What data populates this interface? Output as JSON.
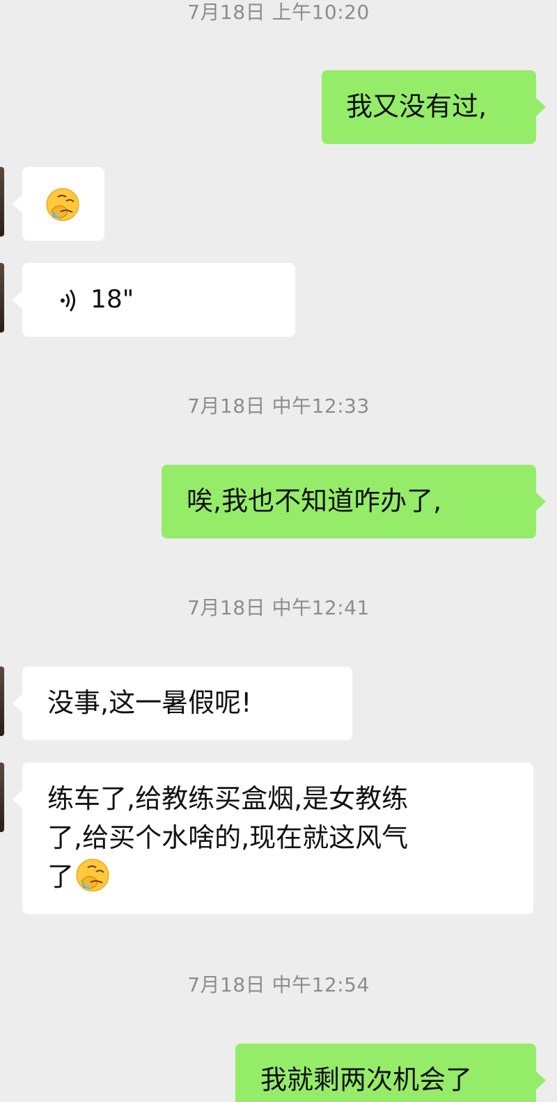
{
  "messages": {
    "ts1": "7月18日 上午10:20",
    "out1": "我又没有过,",
    "in_emoji_name": "facepalm-crying-emoji",
    "voice_duration": "18\"",
    "ts2": "7月18日 中午12:33",
    "out2": "唉,我也不知道咋办了,",
    "ts3": "7月18日 中午12:41",
    "in2": "没事,这一暑假呢!",
    "in3": "练车了,给教练买盒烟,是女教练\n了,给买个水啥的,现在就这风气\n了",
    "ts4": "7月18日 中午12:54",
    "out3": "我就剩两次机会了"
  },
  "colors": {
    "background": "#ededed",
    "incoming_bubble": "#ffffff",
    "outgoing_bubble": "#95ec69",
    "timestamp_text": "#8c8c8c"
  },
  "icons": {
    "voice": "voice-wave-icon",
    "emoji": "facepalm-crying-emoji"
  }
}
